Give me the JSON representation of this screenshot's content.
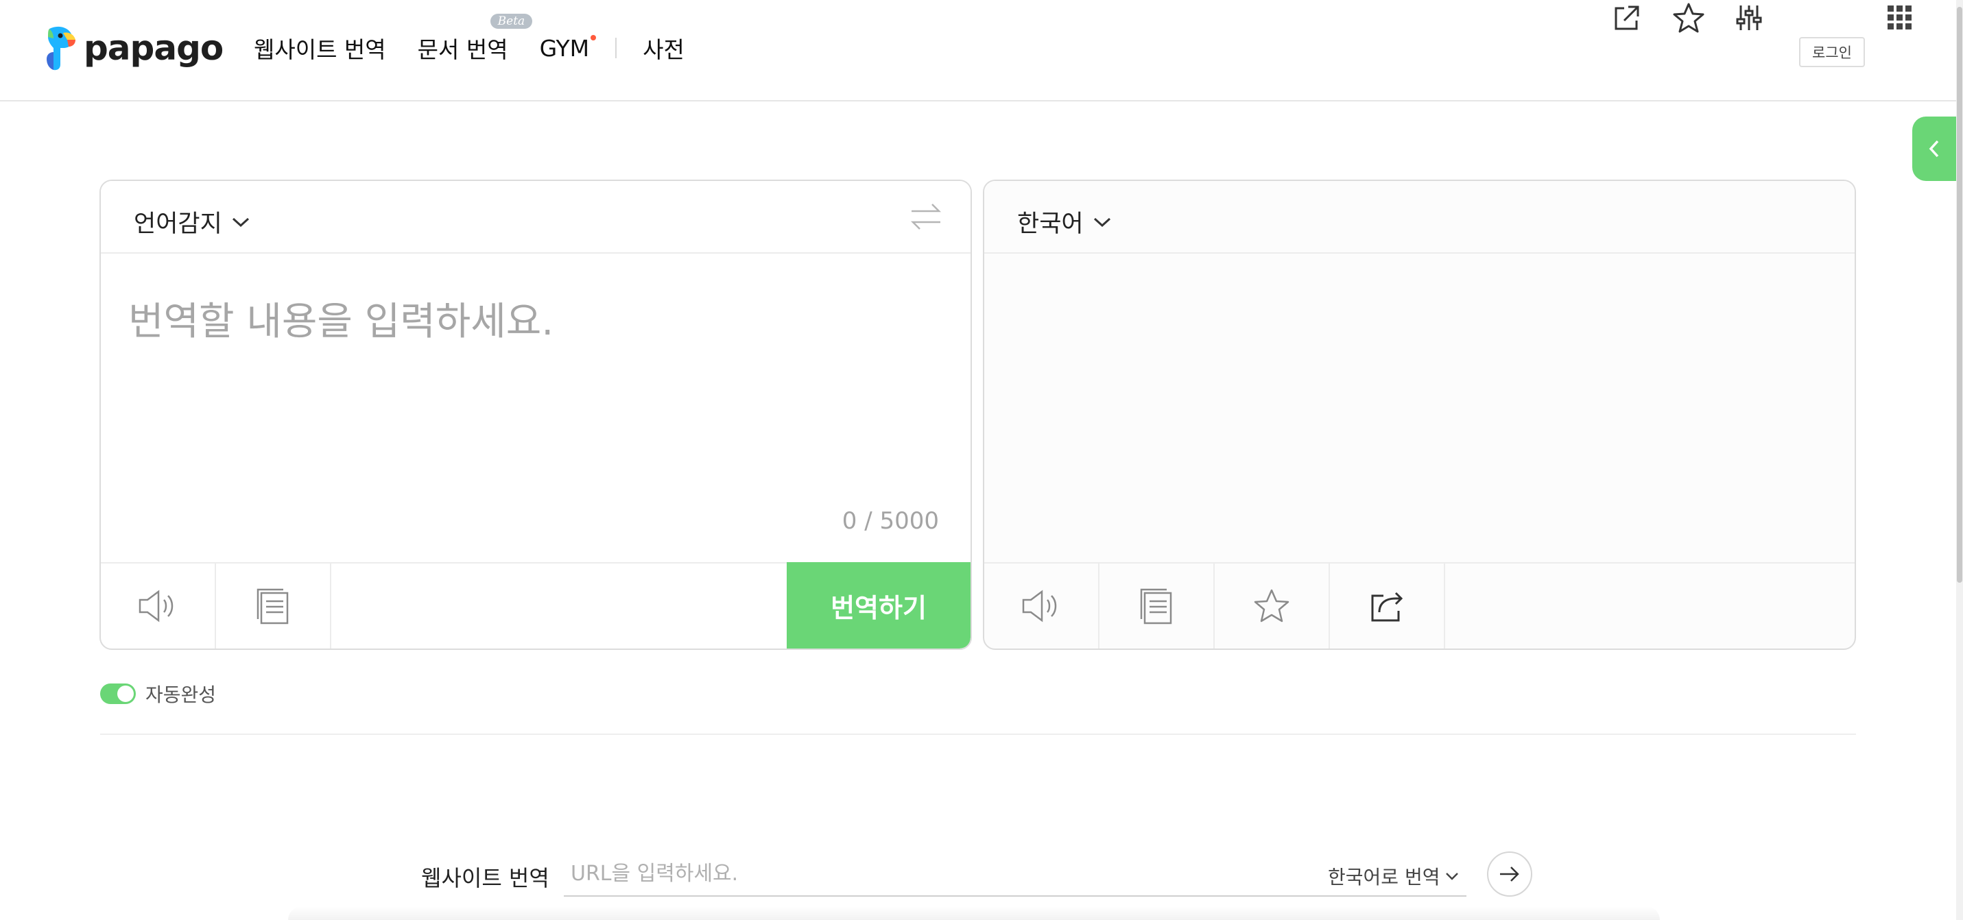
{
  "brand": {
    "name": "papago"
  },
  "nav": {
    "website_translation": "웹사이트 번역",
    "document_translation": "문서 번역",
    "beta_badge": "Beta",
    "gym": "GYM",
    "dictionary": "사전"
  },
  "header": {
    "login_label": "로그인",
    "icons": [
      "external-link-icon",
      "star-icon",
      "settings-sliders-icon",
      "apps-grid-icon"
    ]
  },
  "source": {
    "language": "언어감지",
    "placeholder": "번역할 내용을 입력하세요.",
    "counter": "0 / 5000",
    "translate_button": "번역하기"
  },
  "target": {
    "language": "한국어"
  },
  "autocomplete": {
    "label": "자동완성",
    "enabled": true
  },
  "website": {
    "label": "웹사이트 번역",
    "placeholder": "URL을 입력하세요.",
    "target_language": "한국어로 번역"
  },
  "colors": {
    "accent": "#6ad676",
    "border": "#dcdcdc",
    "placeholder": "#a6a6a6"
  }
}
